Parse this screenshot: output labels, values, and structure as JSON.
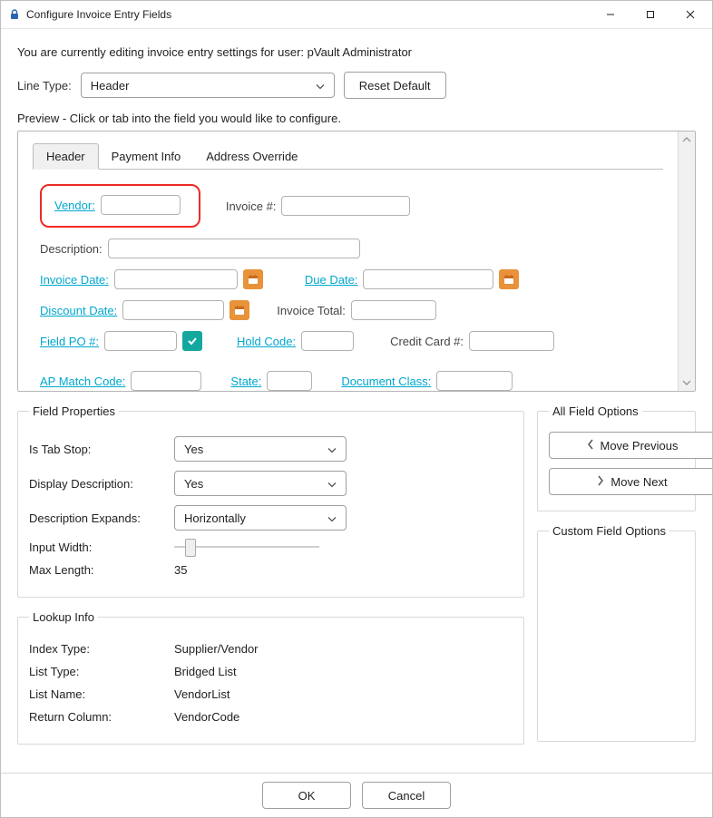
{
  "window": {
    "title": "Configure Invoice Entry Fields"
  },
  "intro": "You are currently editing invoice entry settings for user: pVault Administrator",
  "lineType": {
    "label": "Line Type:",
    "value": "Header"
  },
  "resetDefault": "Reset Default",
  "previewLabel": "Preview - Click or tab into the field you would like to configure.",
  "tabs": {
    "header": "Header",
    "payment": "Payment Info",
    "address": "Address Override"
  },
  "previewFields": {
    "vendor": "Vendor:",
    "invoiceNum": "Invoice #:",
    "description": "Description:",
    "invoiceDate": "Invoice Date:",
    "dueDate": "Due Date:",
    "discountDate": "Discount Date:",
    "invoiceTotal": "Invoice Total:",
    "fieldPO": "Field PO #:",
    "holdCode": "Hold Code:",
    "creditCard": "Credit Card #:",
    "apMatch": "AP Match Code:",
    "state": "State:",
    "docClass": "Document Class:"
  },
  "fieldProperties": {
    "legend": "Field Properties",
    "isTabStop": {
      "label": "Is Tab Stop:",
      "value": "Yes"
    },
    "displayDesc": {
      "label": "Display Description:",
      "value": "Yes"
    },
    "descExpands": {
      "label": "Description Expands:",
      "value": "Horizontally"
    },
    "inputWidth": {
      "label": "Input Width:"
    },
    "maxLength": {
      "label": "Max Length:",
      "value": "35"
    }
  },
  "allFieldOptions": {
    "legend": "All Field Options",
    "movePrev": "Move Previous",
    "moveNext": "Move Next"
  },
  "customFieldOptions": {
    "legend": "Custom Field Options"
  },
  "lookupInfo": {
    "legend": "Lookup Info",
    "indexType": {
      "label": "Index Type:",
      "value": "Supplier/Vendor"
    },
    "listType": {
      "label": "List Type:",
      "value": "Bridged List"
    },
    "listName": {
      "label": "List Name:",
      "value": "VendorList"
    },
    "returnColumn": {
      "label": "Return Column:",
      "value": "VendorCode"
    }
  },
  "footer": {
    "ok": "OK",
    "cancel": "Cancel"
  }
}
